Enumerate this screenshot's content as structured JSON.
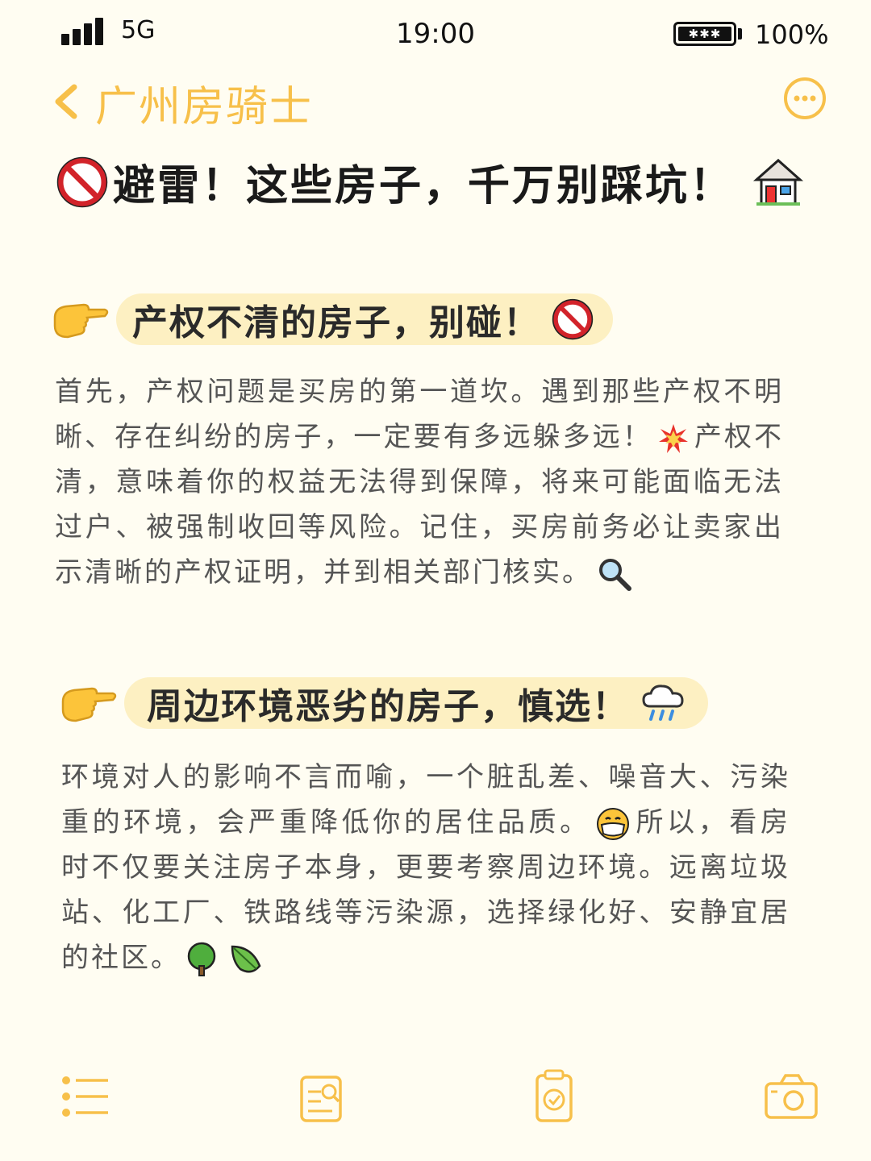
{
  "status_bar": {
    "network": "5G",
    "time": "19:00",
    "battery": "100%"
  },
  "nav": {
    "title": "广州房骑士"
  },
  "page_title": "避雷！这些房子，千万别踩坑！",
  "sections": [
    {
      "heading": "产权不清的房子，别碰！",
      "body_1": "首先，产权问题是买房的第一道坎。遇到那些产权不明晰、存在纠纷的房子，一定要有多远躲多远！",
      "body_2": "产权不清，意味着你的权益无法得到保障，将来可能面临无法过户、被强制收回等风险。记住，买房前务必让卖家出示清晰的产权证明，并到相关部门核实。"
    },
    {
      "heading": "周边环境恶劣的房子，慎选！",
      "body_1": "环境对人的影响不言而喻，一个脏乱差、噪音大、污染重的环境，会严重降低你的居住品质。",
      "body_2": "所以，看房时不仅要关注房子本身，更要考察周边环境。远离垃圾站、化工厂、铁路线等污染源，选择绿化好、安静宜居的社区。"
    }
  ],
  "icons": {
    "accent": "#f7c04a",
    "pill_bg": "#fdf0c2"
  }
}
